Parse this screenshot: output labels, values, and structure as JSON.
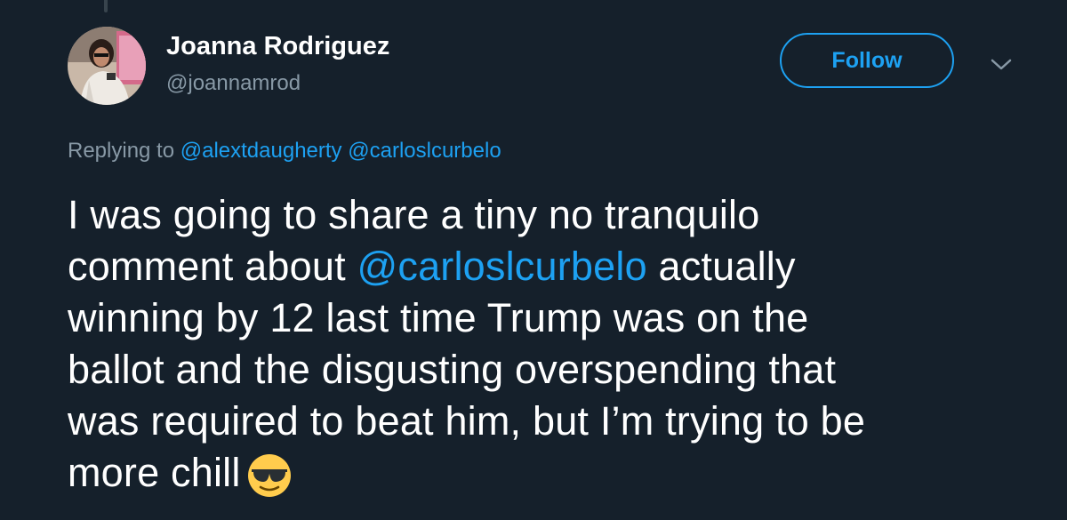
{
  "author": {
    "display_name": "Joanna Rodriguez",
    "handle": "@joannamrod"
  },
  "actions": {
    "follow_label": "Follow",
    "menu_icon": "chevron-down-icon"
  },
  "reply_context": {
    "prefix": "Replying to",
    "mentions": [
      "@alextdaugherty",
      "@carloslcurbelo"
    ]
  },
  "tweet": {
    "line1": "I was going to share a tiny no tranquilo",
    "line2_before": "comment about",
    "line2_mention": "@carloslcurbelo",
    "line2_after": "actually",
    "line3": "winning by 12 last time Trump was on the",
    "line4": "ballot and the disgusting overspending that",
    "line5": "was required to beat him, but I’m trying to be",
    "line6": "more chill",
    "emoji": "smiling-face-with-sunglasses"
  },
  "colors": {
    "background": "#15202b",
    "accent": "#1da1f2",
    "secondary_text": "#8899a6"
  }
}
